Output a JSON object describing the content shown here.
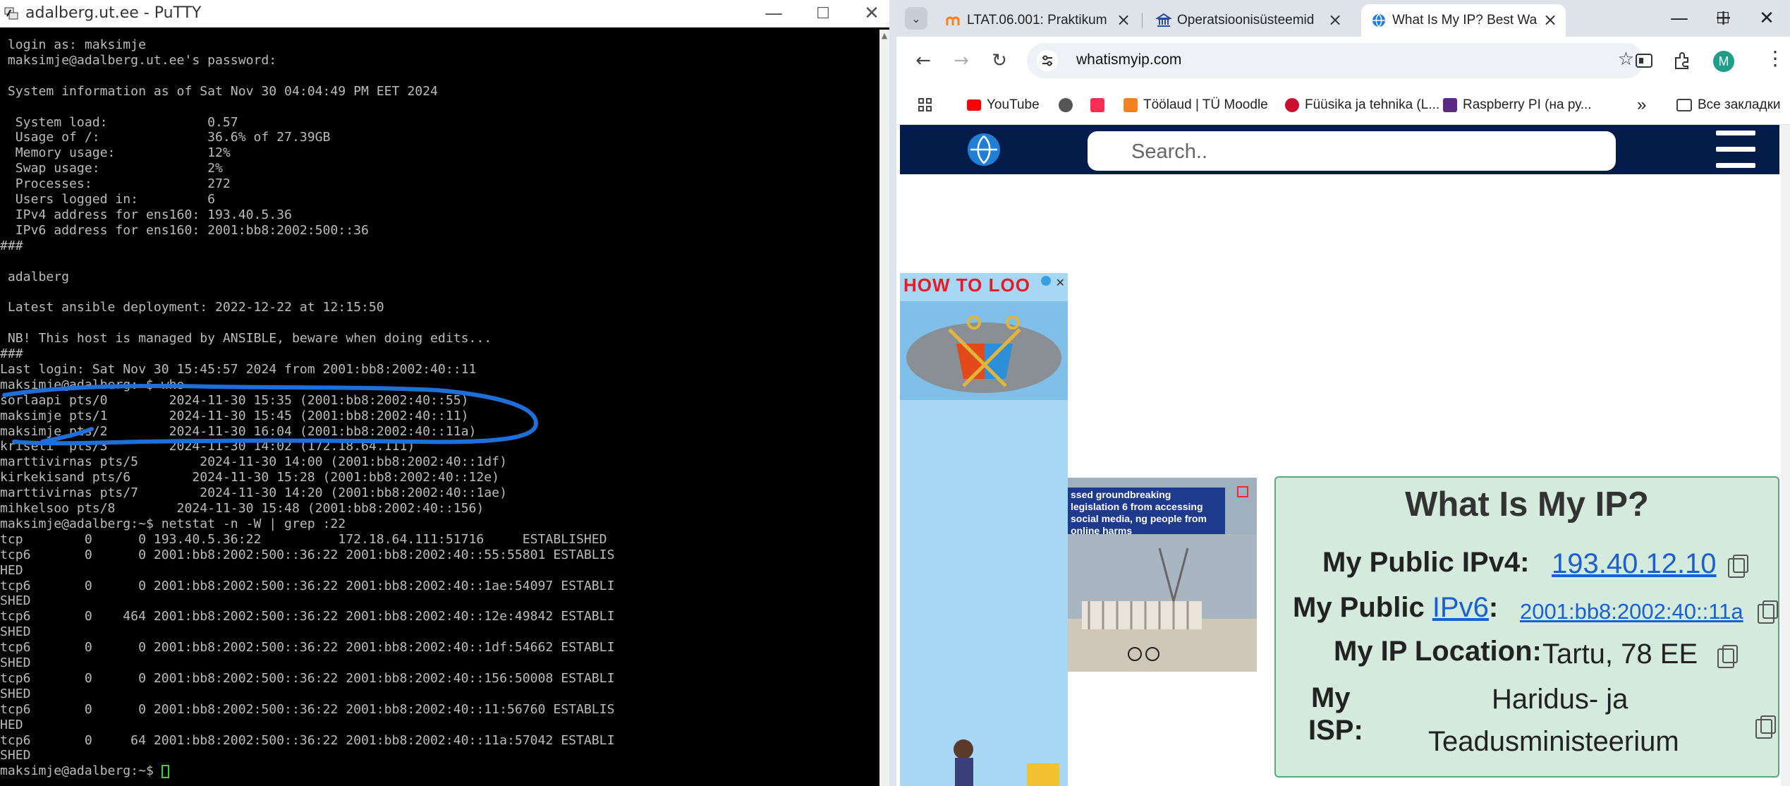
{
  "putty": {
    "title": "adalberg.ut.ee - PuTTY",
    "controls": {
      "minimize": "—",
      "maximize": "☐",
      "close": "✕"
    },
    "lines": [
      " login as: maksimje",
      " maksimje@adalberg.ut.ee's password:",
      "",
      " System information as of Sat Nov 30 04:04:49 PM EET 2024",
      "",
      "  System load:             0.57",
      "  Usage of /:              36.6% of 27.39GB",
      "  Memory usage:            12%",
      "  Swap usage:              2%",
      "  Processes:               272",
      "  Users logged in:         6",
      "  IPv4 address for ens160: 193.40.5.36",
      "  IPv6 address for ens160: 2001:bb8:2002:500::36",
      "###",
      "",
      " adalberg",
      "",
      " Latest ansible deployment: 2022-12-22 at 12:15:50",
      "",
      " NB! This host is managed by ANSIBLE, beware when doing edits...",
      "###",
      "Last login: Sat Nov 30 15:45:57 2024 from 2001:bb8:2002:40::11",
      "maksimje@adalberg:~$ who",
      "sorlaapi pts/0        2024-11-30 15:35 (2001:bb8:2002:40::55)",
      "maksimje pts/1        2024-11-30 15:45 (2001:bb8:2002:40::11)",
      "maksimje pts/2        2024-11-30 16:04 (2001:bb8:2002:40::11a)",
      "kriseti  pts/3        2024-11-30 14:02 (172.18.64.111)",
      "marttivirnas pts/5        2024-11-30 14:00 (2001:bb8:2002:40::1df)",
      "kirkekisand pts/6        2024-11-30 15:28 (2001:bb8:2002:40::12e)",
      "marttivirnas pts/7        2024-11-30 14:20 (2001:bb8:2002:40::1ae)",
      "mihkelsoo pts/8        2024-11-30 15:48 (2001:bb8:2002:40::156)",
      "maksimje@adalberg:~$ netstat -n -W | grep :22",
      "tcp        0      0 193.40.5.36:22          172.18.64.111:51716     ESTABLISHED",
      "tcp6       0      0 2001:bb8:2002:500::36:22 2001:bb8:2002:40::55:55801 ESTABLIS",
      "HED",
      "tcp6       0      0 2001:bb8:2002:500::36:22 2001:bb8:2002:40::1ae:54097 ESTABLI",
      "SHED",
      "tcp6       0    464 2001:bb8:2002:500::36:22 2001:bb8:2002:40::12e:49842 ESTABLI",
      "SHED",
      "tcp6       0      0 2001:bb8:2002:500::36:22 2001:bb8:2002:40::1df:54662 ESTABLI",
      "SHED",
      "tcp6       0      0 2001:bb8:2002:500::36:22 2001:bb8:2002:40::156:50008 ESTABLI",
      "SHED",
      "tcp6       0      0 2001:bb8:2002:500::36:22 2001:bb8:2002:40::11:56760 ESTABLIS",
      "HED",
      "tcp6       0     64 2001:bb8:2002:500::36:22 2001:bb8:2002:40::11a:57042 ESTABLI",
      "SHED",
      "maksimje@adalberg:~$ "
    ],
    "annotation_color": "#1e6fd9",
    "cursor_color": "#2fd82f"
  },
  "browser": {
    "tabs": [
      {
        "title": "LTAT.06.001: Praktikum",
        "active": false
      },
      {
        "title": "Operatsioonisüsteemid",
        "active": false
      },
      {
        "title": "What Is My IP? Best Wa",
        "active": true
      }
    ],
    "new_tab": "+",
    "controls": {
      "minimize": "—",
      "maximize": "☐",
      "close": "✕"
    },
    "address": "whatismyip.com",
    "bookmarks": [
      "YouTube",
      "Töölaud | TÜ Moodle",
      "Füüsika ja tehnika (L...",
      "Raspberry PI (на ру...",
      "»",
      "Все закладки"
    ],
    "profile_initial": "M",
    "profile_color": "#1c9e88"
  },
  "site": {
    "search_placeholder": "Search..",
    "ad_left_header": "HOW TO LOO",
    "ad_news_headline": "ssed groundbreaking legislation 6 from accessing social media, ng people from online harms",
    "card": {
      "title": "What Is My IP?",
      "ipv4_label": "My Public IPv4:",
      "ipv4_value": "193.40.12.10",
      "ipv6_label_prefix": "My Public ",
      "ipv6_label_link": "IPv6",
      "ipv6_label_suffix": ":",
      "ipv6_value": "2001:bb8:2002:40::11a",
      "location_label": "My IP Location:",
      "location_value": "Tartu, 78 EE",
      "isp_label_1": "My",
      "isp_label_2": "ISP:",
      "isp_value_1": "Haridus- ja",
      "isp_value_2": "Teadusministeerium"
    },
    "header_color": "#041c4a",
    "card_color": "#d3eadd"
  }
}
